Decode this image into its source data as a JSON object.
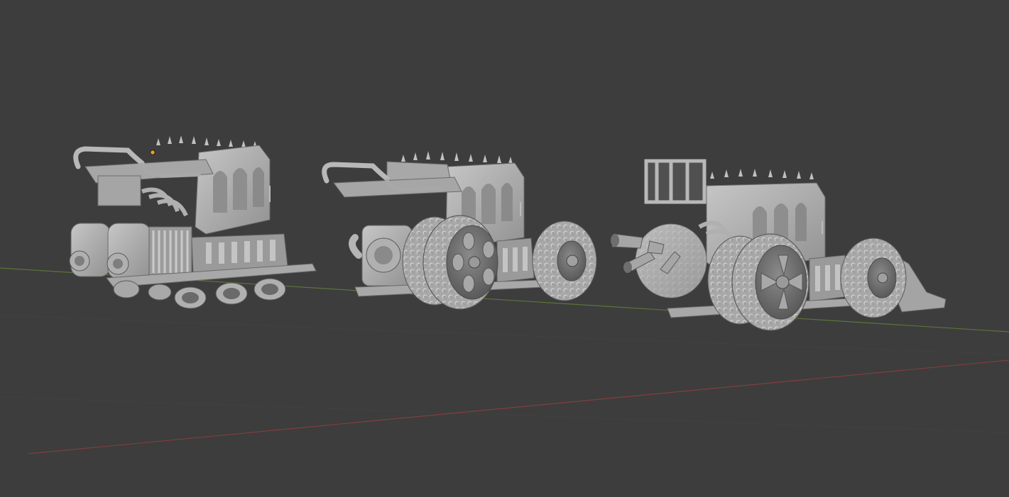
{
  "viewport": {
    "background": "#3d3d3d",
    "shading": "solid",
    "model_color": "#b4b4b4",
    "model_shadow": "#6e6e6e",
    "model_highlight": "#d2d2d2",
    "x_axis_color": "#8a3e3e",
    "y_axis_color": "#5e7a3a",
    "origin_color": "#f0a020"
  },
  "objects": [
    {
      "id": "vehicle-1",
      "kind": "engine-sled",
      "selected": true
    },
    {
      "id": "vehicle-2",
      "kind": "wheeled-kart",
      "selected": false
    },
    {
      "id": "vehicle-3",
      "kind": "wheeled-kart-with-plow",
      "selected": false
    }
  ]
}
